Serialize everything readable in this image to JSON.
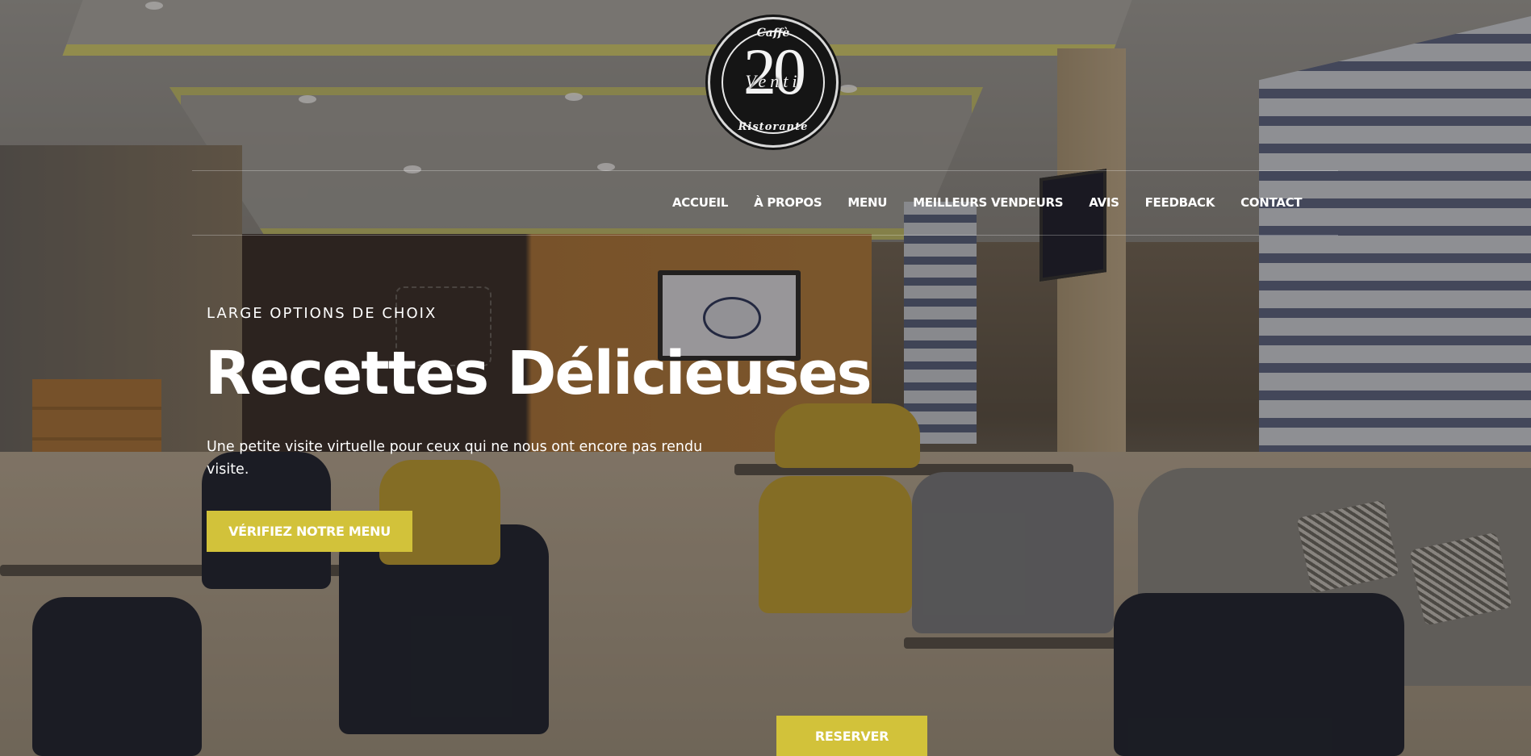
{
  "logo": {
    "top_text": "Caffè",
    "number": "20",
    "middle_text": "Venti",
    "bottom_text": "Ristorante"
  },
  "nav": {
    "items": [
      {
        "label": "ACCUEIL"
      },
      {
        "label": "À PROPOS"
      },
      {
        "label": "MENU"
      },
      {
        "label": "MEILLEURS VENDEURS"
      },
      {
        "label": "AVIS"
      },
      {
        "label": "FEEDBACK"
      },
      {
        "label": "CONTACT"
      }
    ]
  },
  "hero": {
    "eyebrow": "LARGE OPTIONS DE CHOIX",
    "title": "Recettes Délicieuses",
    "description": "Une petite visite virtuelle pour ceux qui ne nous ont encore pas rendu visite.",
    "cta_label": "VÉRIFIEZ NOTRE MENU"
  },
  "reserve_button": {
    "label": "RESERVER"
  },
  "colors": {
    "accent": "#d2c23a",
    "text": "#ffffff",
    "logo_bg": "#151515"
  }
}
